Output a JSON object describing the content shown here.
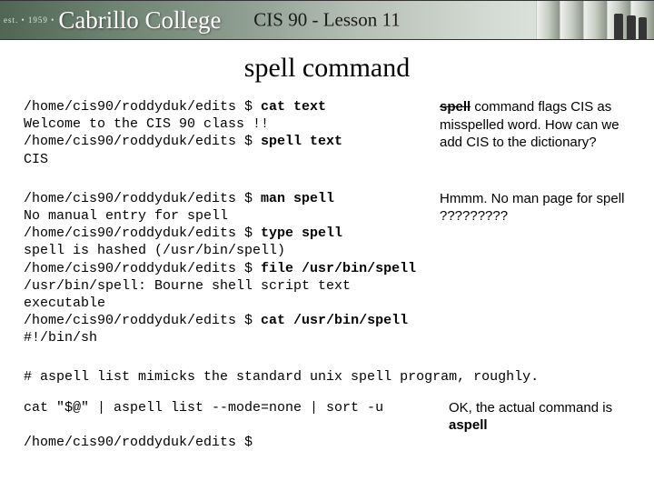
{
  "banner": {
    "est": "est. • 1959 •",
    "logo": "Cabrillo College",
    "title": "CIS 90 - Lesson 11"
  },
  "slide_title": "spell command",
  "block1": {
    "l1_prompt": "/home/cis90/roddyduk/edits $ ",
    "l1_cmd": "cat text",
    "l2": "Welcome to the CIS 90 class !!",
    "l3_prompt": "/home/cis90/roddyduk/edits $ ",
    "l3_cmd": "spell text",
    "l4": "CIS"
  },
  "aside1": {
    "a": "spell",
    "b": " command flags CIS as misspelled word.  How can we add CIS to the dictionary?"
  },
  "block2": {
    "l1_prompt": "/home/cis90/roddyduk/edits $ ",
    "l1_cmd": "man spell",
    "l2": "No manual entry for spell",
    "l3_prompt": "/home/cis90/roddyduk/edits $ ",
    "l3_cmd": "type spell",
    "l4": "spell is hashed (/usr/bin/spell)",
    "l5_prompt": "/home/cis90/roddyduk/edits $ ",
    "l5_cmd": "file /usr/bin/spell",
    "l6": "/usr/bin/spell: Bourne shell script text executable",
    "l7_prompt": "/home/cis90/roddyduk/edits $ ",
    "l7_cmd": "cat /usr/bin/spell",
    "l8": "#!/bin/sh"
  },
  "aside2": {
    "text": "Hmmm.  No man page for spell ?????????"
  },
  "comment": "# aspell list mimicks the standard unix spell program, roughly.",
  "block3": {
    "l1": "cat \"$@\" | aspell list --mode=none | sort -u",
    "l2": "/home/cis90/roddyduk/edits $"
  },
  "aside3": {
    "a": "OK, the actual command is ",
    "b": "aspell"
  }
}
